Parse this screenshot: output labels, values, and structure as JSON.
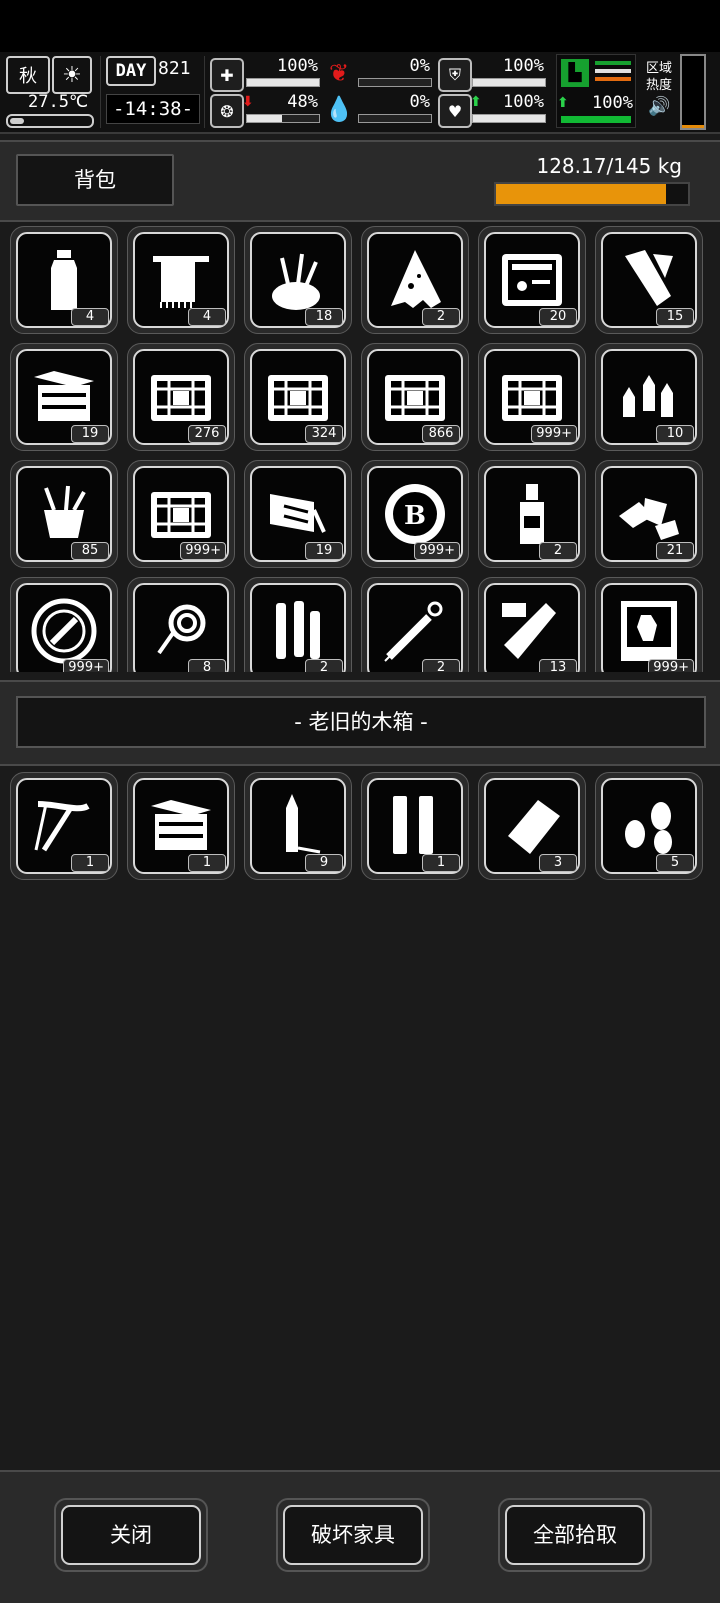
{
  "hud": {
    "season": "秋",
    "temperature": "27.5℃",
    "day_label": "DAY",
    "day_number": "821",
    "time": "-14:38-",
    "health": "100%",
    "health_level": 1.0,
    "hunger": "0%",
    "hunger_level": 0.0,
    "armor": "100%",
    "armor_level": 1.0,
    "mood": "48%",
    "mood_level": 0.48,
    "thirst": "0%",
    "thirst_level": 0.0,
    "heart": "100%",
    "heart_level": 1.0,
    "stamina": "100%",
    "zone_label": "区域热度"
  },
  "backpack": {
    "title": "背包",
    "weight": "128.17/145 kg",
    "weight_fill": 0.884
  },
  "inventory": [
    {
      "icon": "water-bottle-icon",
      "count": "4"
    },
    {
      "icon": "towel-icon",
      "count": "4"
    },
    {
      "icon": "tool-bag-icon",
      "count": "18"
    },
    {
      "icon": "cloth-scrap-icon",
      "count": "2"
    },
    {
      "icon": "tool-case-icon",
      "count": "20"
    },
    {
      "icon": "bandage-roll-icon",
      "count": "15"
    },
    {
      "icon": "toolbox-icon",
      "count": "19"
    },
    {
      "icon": "crate-icon",
      "count": "276"
    },
    {
      "icon": "crate-icon",
      "count": "324"
    },
    {
      "icon": "crate-icon",
      "count": "866"
    },
    {
      "icon": "crate-icon",
      "count": "999+"
    },
    {
      "icon": "bullets-icon",
      "count": "10"
    },
    {
      "icon": "tool-bucket-icon",
      "count": "85"
    },
    {
      "icon": "crate-icon",
      "count": "999+"
    },
    {
      "icon": "repair-kit-icon",
      "count": "19"
    },
    {
      "icon": "coin-icon",
      "count": "999+"
    },
    {
      "icon": "liquor-bottle-icon",
      "count": "2"
    },
    {
      "icon": "fabric-pieces-icon",
      "count": "21"
    },
    {
      "icon": "wrench-badge-icon",
      "count": "999+"
    },
    {
      "icon": "rope-icon",
      "count": "8"
    },
    {
      "icon": "tubes-icon",
      "count": "2"
    },
    {
      "icon": "syringe-icon",
      "count": "2"
    },
    {
      "icon": "test-tube-icon",
      "count": "13"
    },
    {
      "icon": "zombie-card-icon",
      "count": "999+"
    }
  ],
  "container": {
    "title": "- 老旧的木箱 -",
    "items": [
      {
        "icon": "bow-icon",
        "count": "1"
      },
      {
        "icon": "toolbox-icon",
        "count": "1"
      },
      {
        "icon": "rifle-bullet-icon",
        "count": "9"
      },
      {
        "icon": "shell-casings-icon",
        "count": "1"
      },
      {
        "icon": "cloth-piece-icon",
        "count": "3"
      },
      {
        "icon": "pistol-rounds-icon",
        "count": "5"
      }
    ]
  },
  "buttons": {
    "close": "关闭",
    "destroy": "破坏家具",
    "take_all": "全部拾取"
  }
}
